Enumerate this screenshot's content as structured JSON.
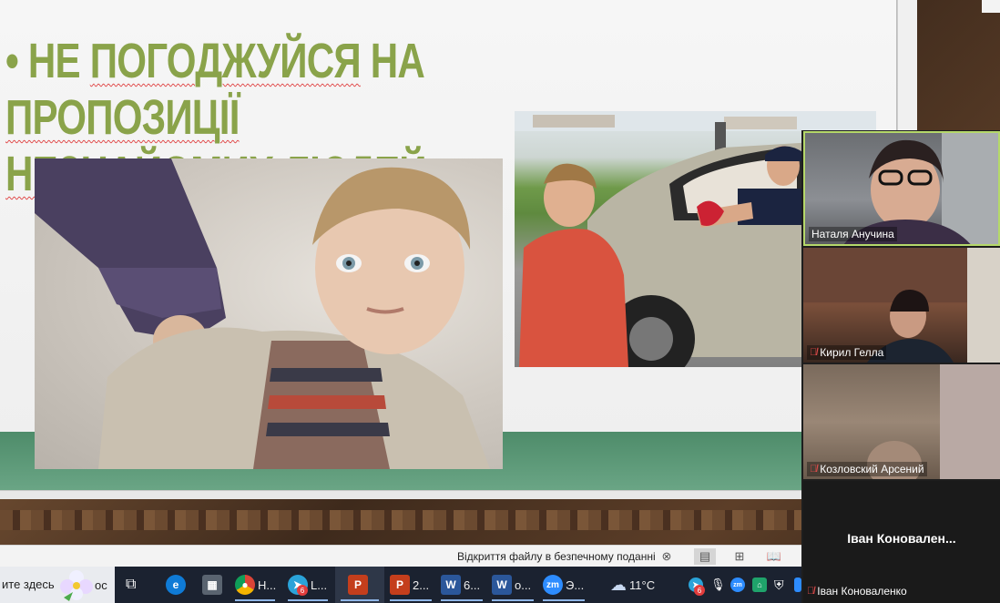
{
  "slide": {
    "bullet": "•",
    "title_part1": "НЕ",
    "title_word2": "ПОГОДЖУЙСЯ",
    "title_part3": "НА",
    "title_word4": "ПРОПОЗИЦІЇ",
    "title_word5": "НЕЗНАЙОМИХ",
    "title_part6": "ЛЮДЕЙ;"
  },
  "participants": [
    {
      "name": "Наталя Анучина",
      "muted": false
    },
    {
      "name": "Кирил Гелла",
      "muted": true
    },
    {
      "name": "Козловский Арсений",
      "muted": true
    },
    {
      "name": "Іван Коноваленко",
      "muted": true,
      "display": "Іван  Коновален..."
    }
  ],
  "statusbar": {
    "message": "Відкриття файлу в безпечному поданні"
  },
  "taskbar": {
    "search_text": "ите здесь",
    "search_suffix": "ос",
    "apps": [
      {
        "label": "Н...",
        "icon": "chrome-icon"
      },
      {
        "label": "L...",
        "icon": "telegram-icon",
        "badge": "6"
      },
      {
        "label": "2...",
        "icon": "powerpoint-icon"
      },
      {
        "label": "6...",
        "icon": "word-icon"
      },
      {
        "label": "о...",
        "icon": "word-icon"
      },
      {
        "label": "Э...",
        "icon": "zoom-icon"
      }
    ],
    "weather": "11°C",
    "tray_badge": "6",
    "colors": {
      "powerpoint": "#c43e1c",
      "word": "#2b579a",
      "zoom": "#2d8cff",
      "chrome": "#db4437",
      "telegram": "#2aa3d9",
      "edge": "#0f7bd6"
    }
  }
}
